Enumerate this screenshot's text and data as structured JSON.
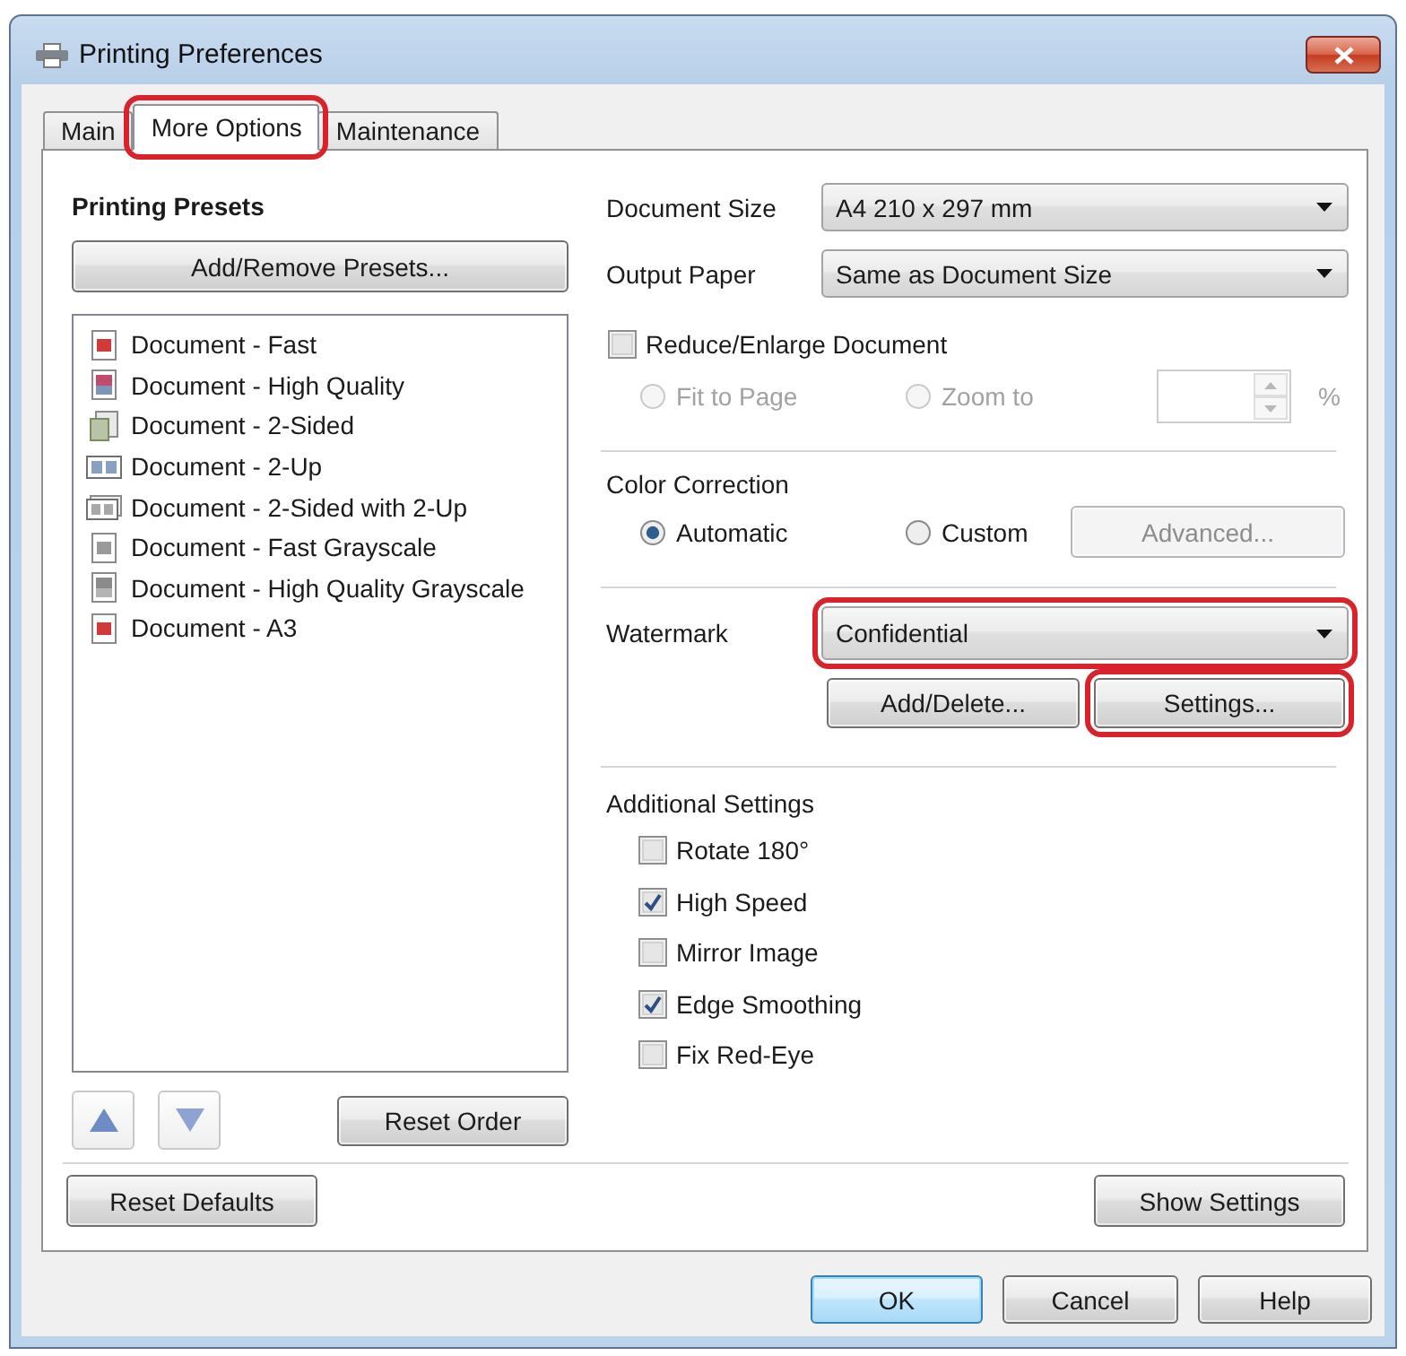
{
  "window": {
    "title": "Printing Preferences"
  },
  "tabs": [
    {
      "label": "Main",
      "selected": false,
      "highlighted": false
    },
    {
      "label": "More Options",
      "selected": true,
      "highlighted": true
    },
    {
      "label": "Maintenance",
      "selected": false,
      "highlighted": false
    }
  ],
  "presets": {
    "title": "Printing Presets",
    "add_remove_button": "Add/Remove Presets...",
    "items": [
      {
        "label": "Document - Fast",
        "kind": "fast",
        "selected": false
      },
      {
        "label": "Document - High Quality",
        "kind": "quality",
        "selected": false
      },
      {
        "label": "Document - 2-Sided",
        "kind": "duplex",
        "selected": false
      },
      {
        "label": "Document - 2-Up",
        "kind": "nup",
        "selected": false
      },
      {
        "label": "Document - 2-Sided with 2-Up",
        "kind": "duplex_nup",
        "selected": false
      },
      {
        "label": "Document - Fast Grayscale",
        "kind": "gray_fast",
        "selected": false
      },
      {
        "label": "Document - High Quality Grayscale",
        "kind": "gray_quality",
        "selected": false
      },
      {
        "label": "Document - A3",
        "kind": "a3",
        "selected": false
      }
    ],
    "reset_order_button": "Reset Order"
  },
  "document_size": {
    "label": "Document Size",
    "value": "A4 210 x 297 mm"
  },
  "output_paper": {
    "label": "Output Paper",
    "value": "Same as Document Size"
  },
  "reduce_enlarge": {
    "label": "Reduce/Enlarge Document",
    "checked": false,
    "options": [
      {
        "label": "Fit to Page",
        "selected": false,
        "disabled": true
      },
      {
        "label": "Zoom to",
        "selected": false,
        "disabled": true
      }
    ],
    "zoom_field": {
      "disabled": true
    },
    "unit": "%"
  },
  "color_correction": {
    "title": "Color Correction",
    "options": [
      {
        "label": "Automatic",
        "selected": true
      },
      {
        "label": "Custom",
        "selected": false
      }
    ],
    "advanced_button": {
      "label": "Advanced...",
      "disabled": true
    }
  },
  "watermark": {
    "label": "Watermark",
    "value": "Confidential",
    "highlighted": true,
    "buttons": [
      {
        "label": "Add/Delete...",
        "highlighted": false
      },
      {
        "label": "Settings...",
        "highlighted": true
      }
    ]
  },
  "additional_settings": {
    "title": "Additional Settings",
    "options": [
      {
        "label": "Rotate 180°",
        "checked": false
      },
      {
        "label": "High Speed",
        "checked": true
      },
      {
        "label": "Mirror Image",
        "checked": false
      },
      {
        "label": "Edge Smoothing",
        "checked": true
      },
      {
        "label": "Fix Red-Eye",
        "checked": false
      }
    ]
  },
  "reset_defaults_button": "Reset Defaults",
  "show_settings_button": "Show Settings",
  "dialog_buttons": [
    {
      "label": "OK",
      "default": true
    },
    {
      "label": "Cancel",
      "default": false
    },
    {
      "label": "Help",
      "default": false
    }
  ]
}
